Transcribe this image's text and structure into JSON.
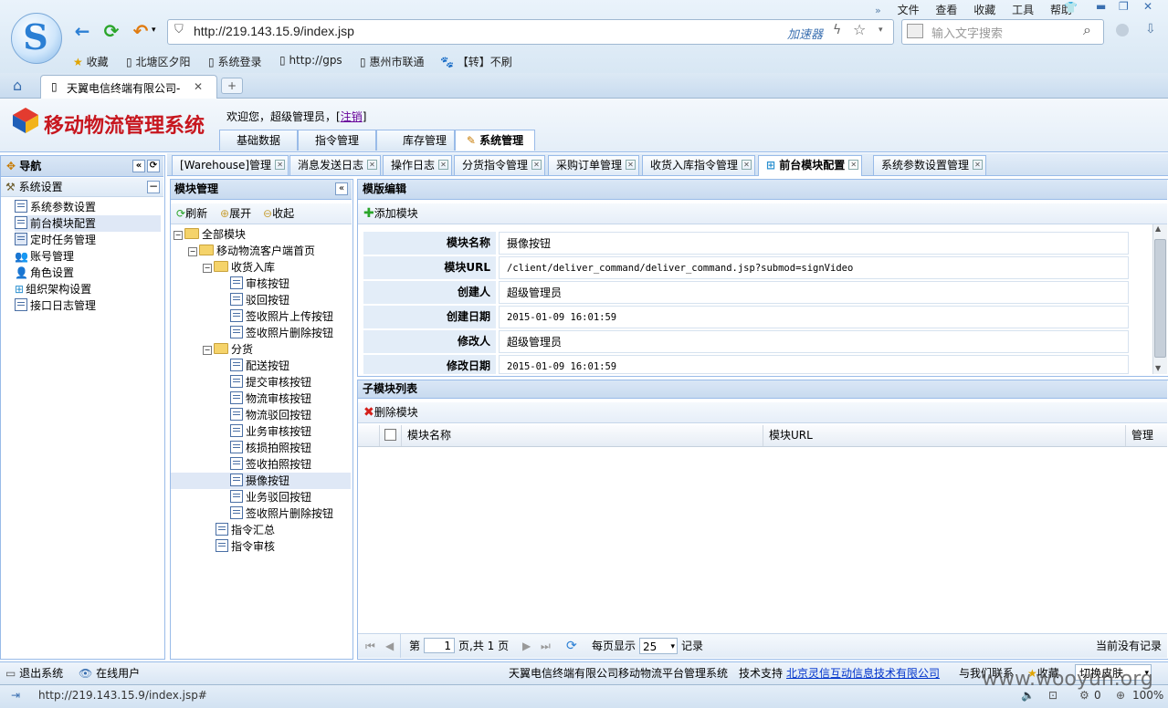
{
  "browser": {
    "menu": [
      "文件",
      "查看",
      "收藏",
      "工具",
      "帮助"
    ],
    "url": "http://219.143.15.9/index.jsp",
    "accelerator": "加速器",
    "search_placeholder": "输入文字搜索",
    "bookmarks": [
      "收藏",
      "北塘区夕阳",
      "系统登录",
      "http://gps",
      "惠州市联通",
      "【转】不刷"
    ],
    "tab_title": "天翼电信终端有限公司-",
    "status_url": "http://219.143.15.9/index.jsp#",
    "zoom": "100%",
    "status_count": "0"
  },
  "app": {
    "title": "移动物流管理系统",
    "welcome": "欢迎您，超级管理员，",
    "logout": "注销",
    "main_tabs": [
      "基础数据",
      "指令管理",
      "库存管理",
      "系统管理"
    ]
  },
  "nav": {
    "title": "导航",
    "group": "系统设置",
    "items": [
      "系统参数设置",
      "前台模块配置",
      "定时任务管理",
      "账号管理",
      "角色设置",
      "组织架构设置",
      "接口日志管理"
    ]
  },
  "content_tabs": [
    "[Warehouse]管理",
    "消息发送日志",
    "操作日志",
    "分货指令管理",
    "采购订单管理",
    "收货入库指令管理",
    "前台模块配置",
    "系统参数设置管理"
  ],
  "tree": {
    "title": "模块管理",
    "tools": [
      "刷新",
      "展开",
      "收起"
    ],
    "nodes": [
      "全部模块",
      "移动物流客户端首页",
      "收货入库",
      "审核按钮",
      "驳回按钮",
      "签收照片上传按钮",
      "签收照片删除按钮",
      "分货",
      "配送按钮",
      "提交审核按钮",
      "物流审核按钮",
      "物流驳回按钮",
      "业务审核按钮",
      "核损拍照按钮",
      "签收拍照按钮",
      "摄像按钮",
      "业务驳回按钮",
      "签收照片删除按钮",
      "指令汇总",
      "指令审核"
    ]
  },
  "edit": {
    "title": "模版编辑",
    "add_button": "添加模块",
    "fields": [
      {
        "label": "模块名称",
        "value": "摄像按钮"
      },
      {
        "label": "模块URL",
        "value": "/client/deliver_command/deliver_command.jsp?submod=signVideo"
      },
      {
        "label": "创建人",
        "value": "超级管理员"
      },
      {
        "label": "创建日期",
        "value": "2015-01-09 16:01:59"
      },
      {
        "label": "修改人",
        "value": "超级管理员"
      },
      {
        "label": "修改日期",
        "value": "2015-01-09 16:01:59"
      }
    ]
  },
  "sub": {
    "title": "子模块列表",
    "delete_button": "删除模块",
    "columns": [
      "模块名称",
      "模块URL",
      "管理"
    ],
    "pager": {
      "page_label": "第",
      "page_value": "1",
      "page_of": "页,共 1 页",
      "per_page_label": "每页显示",
      "per_page_value": "25",
      "records_label": "记录",
      "empty": "当前没有记录"
    }
  },
  "footer": {
    "exit": "退出系统",
    "online": "在线用户",
    "company": "天翼电信终端有限公司移动物流平台管理系统",
    "support_label": "技术支持",
    "support_link": "北京灵信互动信息技术有限公司",
    "contact": "与我们联系",
    "favorite": "收藏",
    "skin": "切换皮肤"
  },
  "watermark": "www.wooyun.org"
}
